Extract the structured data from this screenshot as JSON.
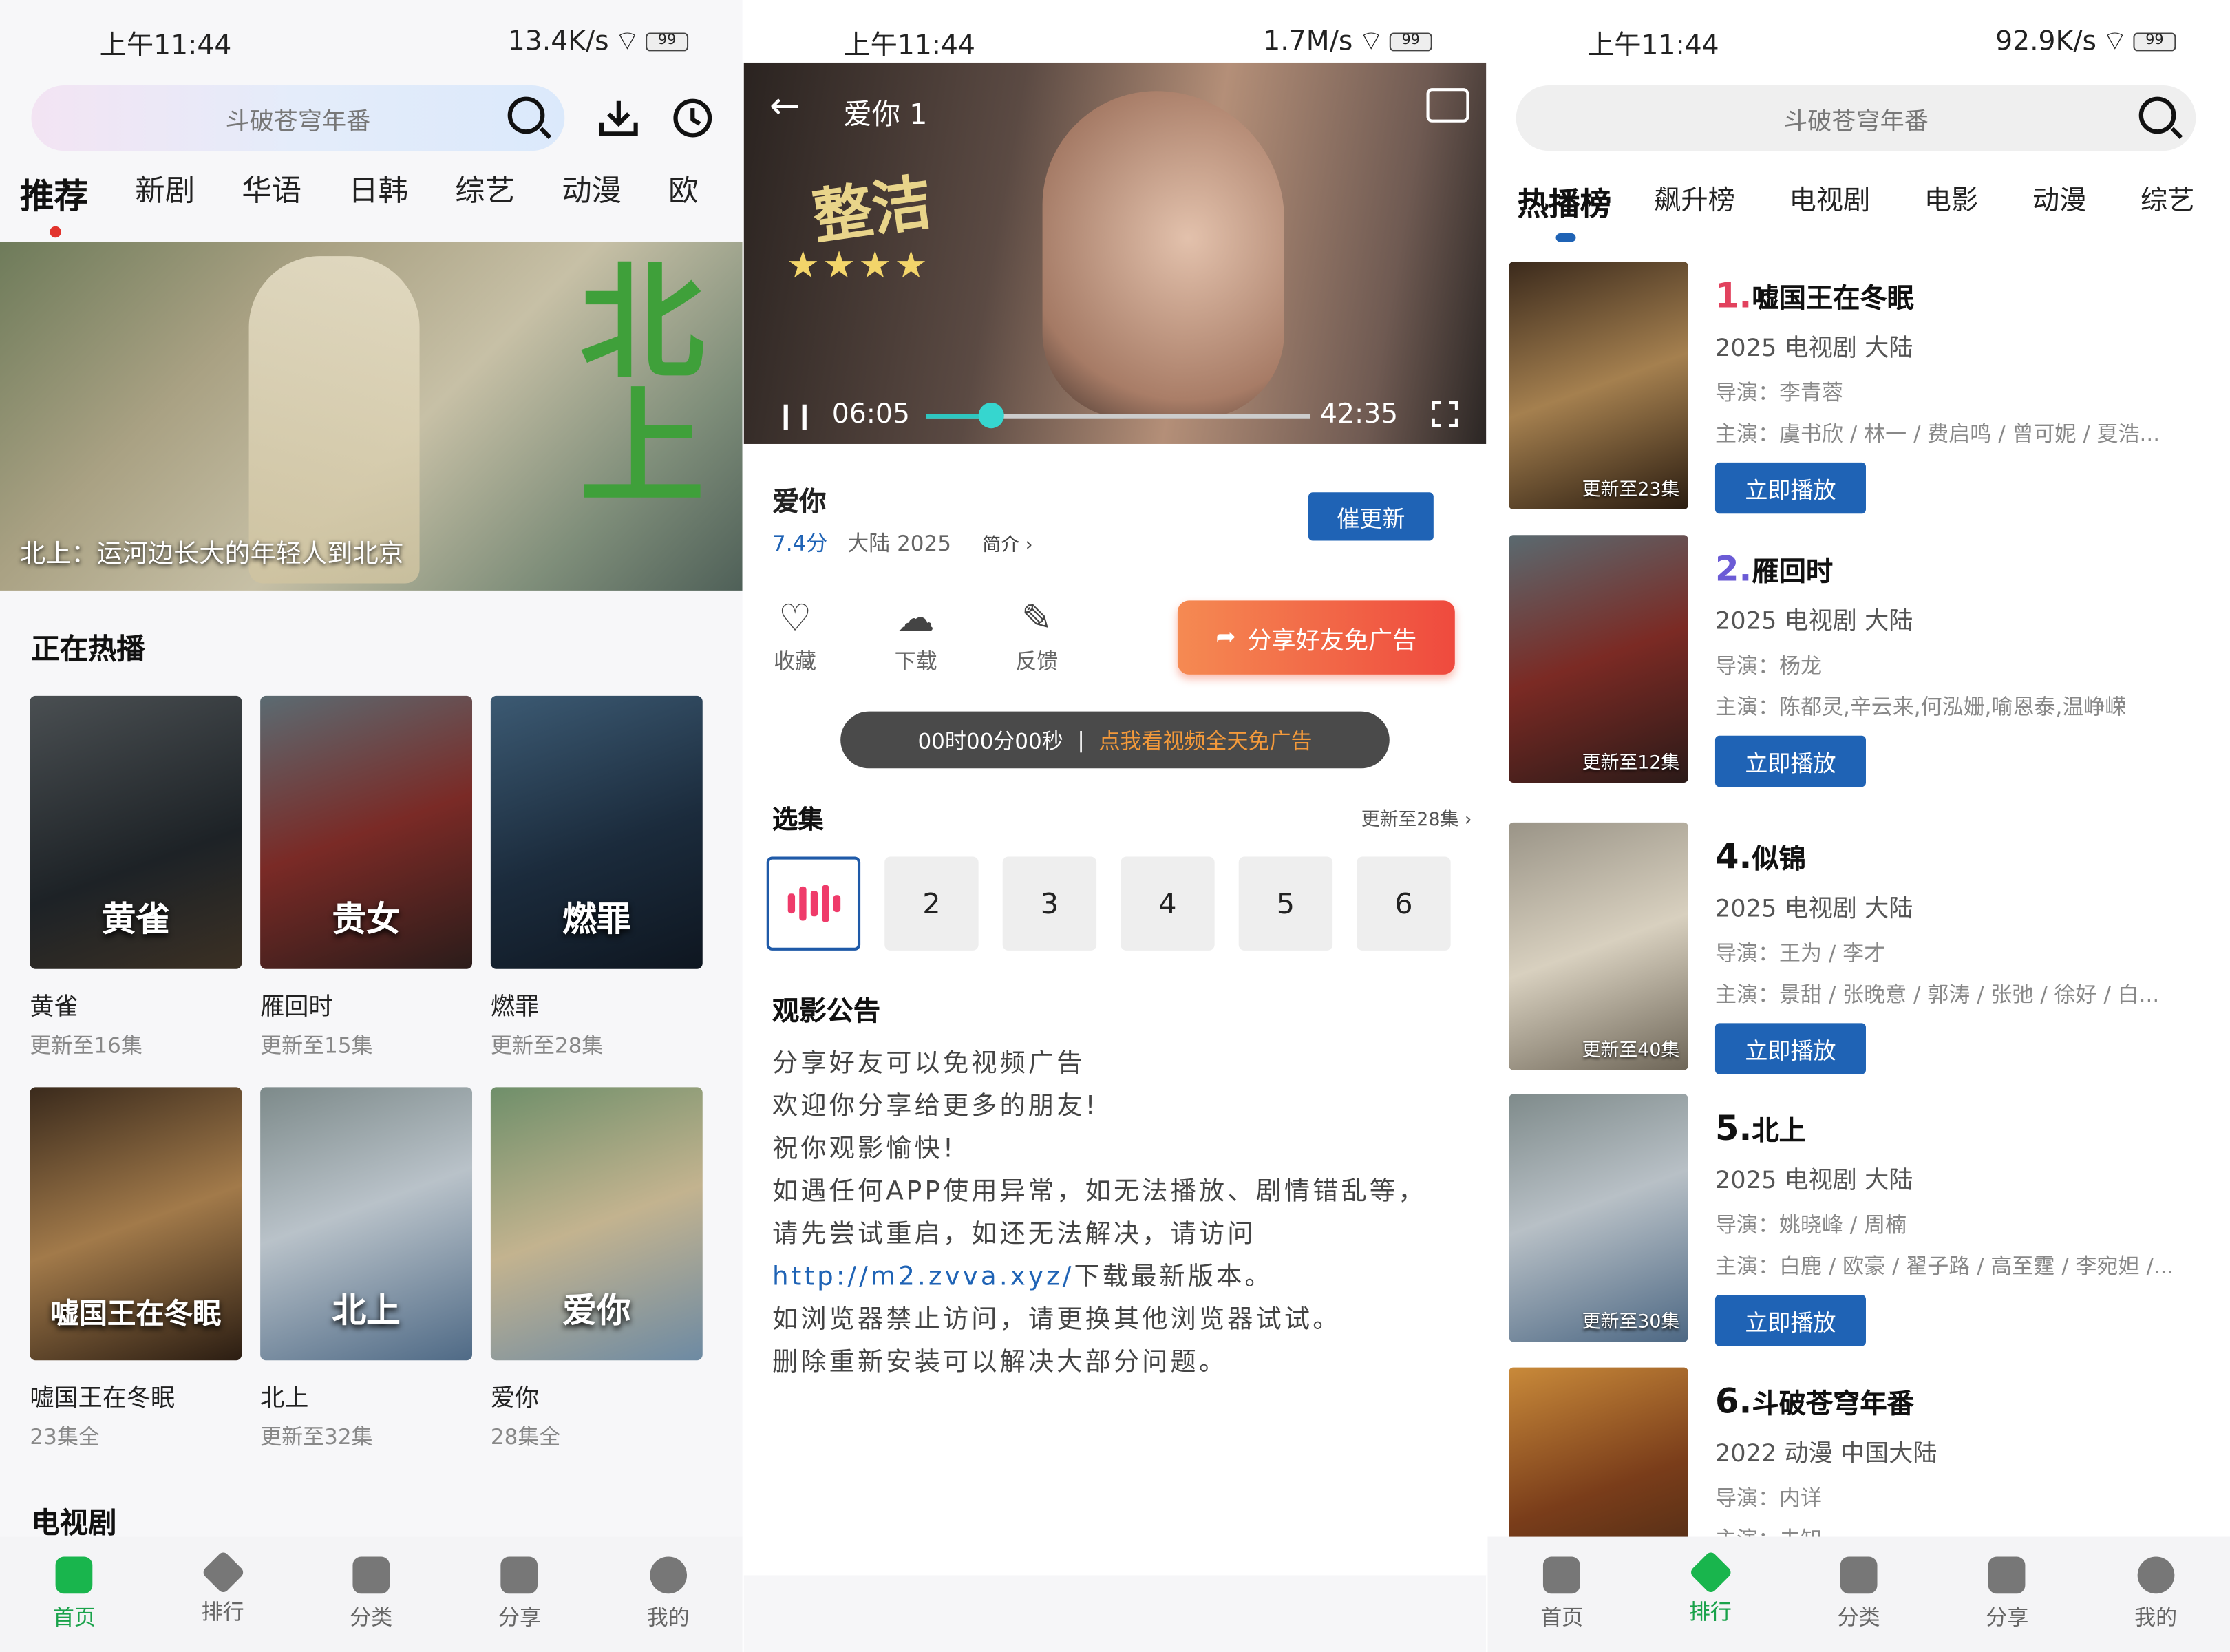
{
  "colors": {
    "accent_green": "#19b54d",
    "accent_blue": "#1f63b5",
    "share_orange": "#ef4a3e",
    "rank_red": "#e2425e",
    "rank_purple": "#6b5bd6"
  },
  "home": {
    "status": {
      "time": "上午11:44",
      "net": "13.4K/s",
      "battery": "99"
    },
    "search_placeholder": "斗破苍穹年番",
    "tabs": [
      "推荐",
      "新剧",
      "华语",
      "日韩",
      "综艺",
      "动漫",
      "欧"
    ],
    "banner": {
      "caption": "北上：运河边长大的年轻人到北京",
      "calligraphy": "北上"
    },
    "hot_title": "正在热播",
    "hot": [
      {
        "title": "黄雀",
        "sub": "更新至16集",
        "poster_text": "黄雀"
      },
      {
        "title": "雁回时",
        "sub": "更新至15集",
        "poster_text": "贵女"
      },
      {
        "title": "燃罪",
        "sub": "更新至28集",
        "poster_text": "燃罪"
      },
      {
        "title": "嘘国王在冬眠",
        "sub": "23集全",
        "poster_text": "嘘国王在冬眠"
      },
      {
        "title": "北上",
        "sub": "更新至32集",
        "poster_text": "北上"
      },
      {
        "title": "爱你",
        "sub": "28集全",
        "poster_text": "爱你"
      }
    ],
    "tv_title": "电视剧",
    "nav": [
      "首页",
      "排行",
      "分类",
      "分享",
      "我的"
    ]
  },
  "detail": {
    "status": {
      "time": "上午11:44",
      "net": "1.7M/s",
      "battery": "99"
    },
    "player": {
      "title": "爱你 1",
      "overlay": "整洁",
      "current": "06:05",
      "total": "42:35",
      "progress": 0.17
    },
    "title": "爱你",
    "score": "7.4分",
    "meta": "大陆  2025",
    "intro": "简介 ›",
    "urge": "催更新",
    "actions": [
      "收藏",
      "下载",
      "反馈"
    ],
    "share": "分享好友免广告",
    "timer": "00时00分00秒",
    "timer_link": "点我看视频全天免广告",
    "episodes_title": "选集",
    "episodes_update": "更新至28集 ›",
    "episodes": [
      "2",
      "3",
      "4",
      "5",
      "6"
    ],
    "notice_title": "观影公告",
    "notice_lines": [
      "分享好友可以免视频广告",
      "欢迎你分享给更多的朋友!",
      "祝你观影愉快!",
      "如遇任何APP使用异常，如无法播放、剧情错乱等，",
      "请先尝试重启，如还无法解决，请访问"
    ],
    "notice_url": "http://m2.zvva.xyz/",
    "notice_url_tail": "下载最新版本。",
    "notice_lines2": [
      "如浏览器禁止访问，请更换其他浏览器试试。",
      "删除重新安装可以解决大部分问题。"
    ]
  },
  "rank": {
    "status": {
      "time": "上午11:44",
      "net": "92.9K/s",
      "battery": "99"
    },
    "search_placeholder": "斗破苍穹年番",
    "tabs": [
      "热播榜",
      "飙升榜",
      "电视剧",
      "电影",
      "动漫",
      "综艺"
    ],
    "play_label": "立即播放",
    "director_label": "导演：",
    "cast_label": "主演：",
    "items": [
      {
        "num": "1.",
        "title": "嘘国王在冬眠",
        "meta": "2025  电视剧  大陆",
        "director": "李青蓉",
        "cast": "虞书欣 / 林一 / 费启鸣 / 曾可妮 / 夏浩...",
        "update": "更新至23集"
      },
      {
        "num": "2.",
        "title": "雁回时",
        "meta": "2025  电视剧  大陆",
        "director": "杨龙",
        "cast": "陈都灵,辛云来,何泓姗,喻恩泰,温峥嵘",
        "update": "更新至12集"
      },
      {
        "num": "4.",
        "title": "似锦",
        "meta": "2025  电视剧  大陆",
        "director": "王为 / 李才",
        "cast": "景甜 / 张晚意 / 郭涛 / 张弛 / 徐好 / 白...",
        "update": "更新至40集"
      },
      {
        "num": "5.",
        "title": "北上",
        "meta": "2025  电视剧  大陆",
        "director": "姚晓峰 / 周楠",
        "cast": "白鹿 / 欧豪 / 翟子路 / 高至霆 / 李宛妲 /...",
        "update": "更新至30集"
      },
      {
        "num": "6.",
        "title": "斗破苍穹年番",
        "meta": "2022  动漫  中国大陆",
        "director": "内详",
        "cast": "未知",
        "update": ""
      }
    ],
    "nav": [
      "首页",
      "排行",
      "分类",
      "分享",
      "我的"
    ]
  }
}
